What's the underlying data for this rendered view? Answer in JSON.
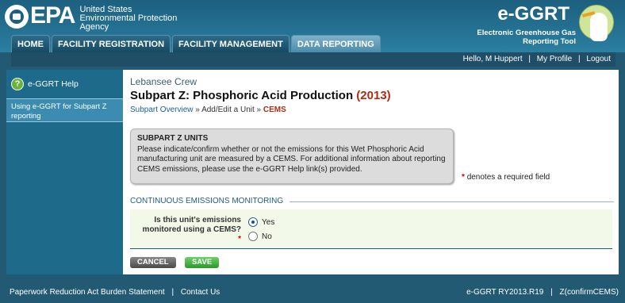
{
  "header": {
    "epa_mark": "EPA",
    "agency_lines": [
      "United States",
      "Environmental Protection",
      "Agency"
    ],
    "app_title": "e-GGRT",
    "app_subtitle_lines": [
      "Electronic Greenhouse Gas",
      "Reporting Tool"
    ]
  },
  "nav": {
    "tabs": [
      "HOME",
      "FACILITY REGISTRATION",
      "FACILITY MANAGEMENT",
      "DATA REPORTING"
    ],
    "active_tab": "DATA REPORTING"
  },
  "userbar": {
    "greeting": "Hello, M Huppert",
    "profile": "My Profile",
    "logout": "Logout",
    "sep": "|"
  },
  "sidebar": {
    "help_label": "e-GGRT Help",
    "help_icon": "?",
    "items": [
      "Using e-GGRT for Subpart Z reporting"
    ]
  },
  "main": {
    "facility": "Lebansee Crew",
    "title": "Subpart Z: Phosphoric Acid Production",
    "year": "(2013)",
    "breadcrumb": {
      "overview": "Subpart Overview",
      "sep1": " » ",
      "add_edit": "Add/Edit a Unit",
      "sep2": " » ",
      "current": "CEMS"
    },
    "infobox": {
      "title": "SUBPART Z UNITS",
      "body": "Please indicate/confirm whether or not the emissions for this Wet Phosphoric Acid manufacturing unit are measured by a CEMS. For additional information about reporting CEMS emissions, please use the e-GGRT Help link(s) provided."
    },
    "required_note": "denotes a required field",
    "asterisk": "*",
    "section_title": "CONTINUOUS EMISSIONS MONITORING",
    "question": "Is this unit's emissions monitored using a CEMS?",
    "options": [
      "Yes",
      "No"
    ],
    "selected_option": "Yes",
    "cancel_label": "CANCEL",
    "save_label": "SAVE"
  },
  "footer": {
    "paperwork": "Paperwork Reduction Act Burden Statement",
    "contact": "Contact Us",
    "version": "e-GGRT RY2013.R19",
    "page_id": "Z(confirmCEMS)",
    "sep": "|"
  }
}
